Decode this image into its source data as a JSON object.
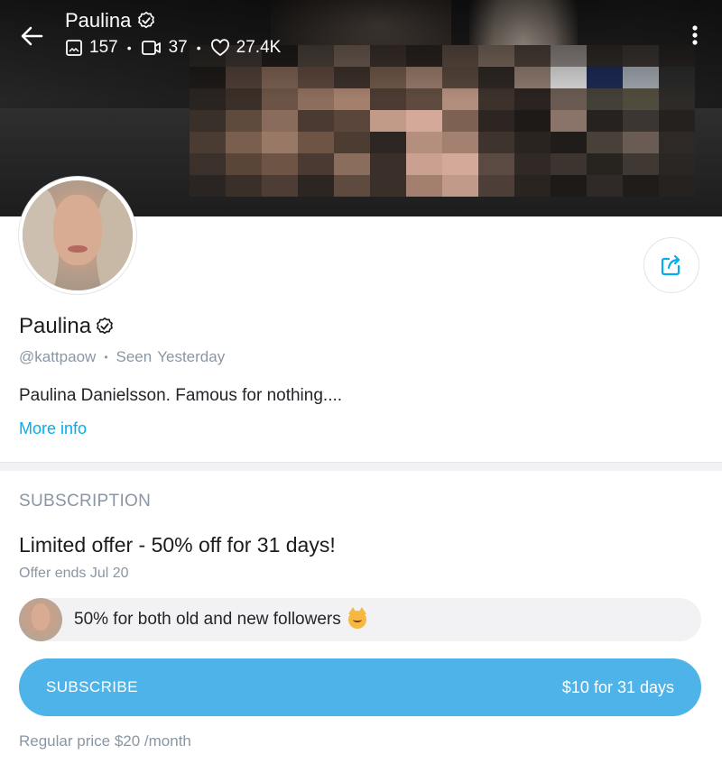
{
  "cover": {
    "name": "Paulina",
    "stats": [
      {
        "icon": "image-icon",
        "value": "157"
      },
      {
        "icon": "video-icon",
        "value": "37"
      },
      {
        "icon": "heart-icon",
        "value": "27.4K"
      }
    ],
    "pixel_colors": [
      "#2b2622",
      "#3b3330",
      "#1f1c1a",
      "#4a4039",
      "#6d5c52",
      "#3a302b",
      "#2a2421",
      "#5a4a41",
      "#7a685c",
      "#4c403a",
      "#8b8481",
      "#2f2a27",
      "#3a3431",
      "#252220",
      "#1d1a18",
      "#4e3f36",
      "#7a5f51",
      "#5b463c",
      "#3c312b",
      "#6f5848",
      "#96796a",
      "#57463c",
      "#2e2724",
      "#8e7a70",
      "#d8d8d8",
      "#1e2a55",
      "#9fa6ad",
      "#2a2a2a",
      "#2a2421",
      "#3b2f29",
      "#6b5446",
      "#8d6d5d",
      "#a37f6c",
      "#4b3b32",
      "#5e4a3f",
      "#b18d7c",
      "#3d312b",
      "#2a2320",
      "#6a5a52",
      "#434038",
      "#504c3d",
      "#2d2a27",
      "#39302a",
      "#5f4a3e",
      "#8a6c5c",
      "#4a3a31",
      "#5a463a",
      "#c29a88",
      "#d4a99a",
      "#7d6254",
      "#2c2522",
      "#1d1a18",
      "#8a7469",
      "#262220",
      "#3c3632",
      "#24211f",
      "#4b3c33",
      "#7a5e4e",
      "#9a7866",
      "#6e5444",
      "#4d3c32",
      "#2e2622",
      "#b58f7e",
      "#a38070",
      "#3f332d",
      "#2a2421",
      "#1f1c1a",
      "#4a403a",
      "#6a5c55",
      "#2e2926",
      "#3c302a",
      "#5a4639",
      "#6d5445",
      "#4a3a31",
      "#8a6d5d",
      "#3a2f29",
      "#caa091",
      "#d5a999",
      "#5a4a41",
      "#302925",
      "#3b342f",
      "#27231f",
      "#3f3833",
      "#2a2623",
      "#2a2522",
      "#3a2f29",
      "#4d3d34",
      "#2c2521",
      "#5e4a3e",
      "#3a2f29",
      "#a27f6f",
      "#c29a8a",
      "#4d3f37",
      "#2a2421",
      "#1d1a18",
      "#2f2a27",
      "#1f1c1a",
      "#262220"
    ]
  },
  "profile": {
    "name": "Paulina",
    "handle": "@kattpaow",
    "seen_label": "Seen",
    "seen_value": "Yesterday",
    "bio": "Paulina Danielsson. Famous for nothing....",
    "more_info": "More info"
  },
  "subscription": {
    "section_title": "SUBSCRIPTION",
    "offer_title": "Limited offer - 50% off for 31 days!",
    "offer_ends": "Offer ends Jul 20",
    "promo_text": "50% for both old and new followers",
    "subscribe_label": "SUBSCRIBE",
    "subscribe_price": "$10 for 31 days",
    "regular_price": "Regular price $20 /month"
  },
  "colors": {
    "accent": "#00aff0",
    "button": "#4db3e8",
    "muted": "#8a96a3"
  }
}
